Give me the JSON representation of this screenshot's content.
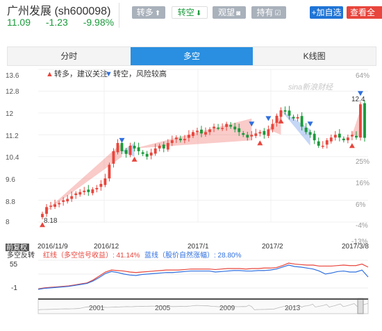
{
  "header": {
    "title": "广州发展 (sh600098)",
    "price": "11.09",
    "change": "-1.23",
    "change_pct": "-9.98%"
  },
  "toolbar": {
    "buttons": [
      {
        "label": "转多",
        "icon": "arrow-up-icon"
      },
      {
        "label": "转空",
        "icon": "arrow-down-icon"
      },
      {
        "label": "观望",
        "icon": "binoculars-icon"
      },
      {
        "label": "持有",
        "icon": "checkbox-icon"
      }
    ],
    "add_label": "+加自选",
    "view_label": "查看全"
  },
  "tabs": [
    {
      "label": "分时",
      "active": false
    },
    {
      "label": "多空",
      "active": true
    },
    {
      "label": "K线图",
      "active": false
    }
  ],
  "chart_data": {
    "type": "candlestick",
    "legend": [
      {
        "marker": "▲",
        "text": "转多，建议关注",
        "color": "#e8453c"
      },
      {
        "marker": "▼",
        "text": "转空，风险较高",
        "color": "#2f6fdf"
      }
    ],
    "watermark": "sina新浪财经",
    "y_ticks_left": [
      "13.6",
      "12.8",
      "12",
      "11.2",
      "10.4",
      "9.6",
      "8.8",
      "8"
    ],
    "y_ticks_right": [
      "64%",
      "",
      "",
      "",
      "",
      "25%",
      "16%",
      "6%",
      "-4%",
      "-13%"
    ],
    "ylim": [
      8.0,
      13.6
    ],
    "x_labels": [
      "2016/11/9",
      "2016/12",
      "2017/1",
      "2017/2",
      "2017/3/8"
    ],
    "low_label": "8.18",
    "high_label": "12.4",
    "closes": [
      8.3,
      8.55,
      8.6,
      8.65,
      8.7,
      8.8,
      8.85,
      8.95,
      9.05,
      9.1,
      9.15,
      9.1,
      9.2,
      9.25,
      9.4,
      9.6,
      10.1,
      10.6,
      10.9,
      10.6,
      10.5,
      10.8,
      10.7,
      10.6,
      10.5,
      10.4,
      10.55,
      10.7,
      10.8,
      10.7,
      10.9,
      11.0,
      11.1,
      11.0,
      11.05,
      11.2,
      11.3,
      11.35,
      11.25,
      11.3,
      11.4,
      11.5,
      11.45,
      11.45,
      11.6,
      11.5,
      11.4,
      11.3,
      11.2,
      11.1,
      11.2,
      11.25,
      11.3,
      11.2,
      11.4,
      11.6,
      11.9,
      12.1,
      12.05,
      11.9,
      11.8,
      11.85,
      11.5,
      11.3,
      11.2,
      11.0,
      10.8,
      10.8,
      11.0,
      11.1,
      11.2,
      11.1,
      11.0,
      11.1,
      11.2,
      11.1,
      12.32,
      11.09
    ],
    "signals": [
      {
        "type": "up",
        "x_frac": 0.0
      },
      {
        "type": "down",
        "x_frac": 0.245
      },
      {
        "type": "up",
        "x_frac": 0.29
      },
      {
        "type": "down",
        "x_frac": 0.655
      },
      {
        "type": "up",
        "x_frac": 0.67
      },
      {
        "type": "down",
        "x_frac": 0.695
      },
      {
        "type": "up",
        "x_frac": 0.745
      },
      {
        "type": "down",
        "x_frac": 0.835
      },
      {
        "type": "up",
        "x_frac": 0.955
      },
      {
        "type": "down",
        "x_frac": 0.985
      }
    ],
    "sub_label_left": "前复权",
    "sub_title": "多空反转",
    "sub_legend_red": "红线（多空信号收益）: 41.14%",
    "sub_legend_blue": "蓝线（股价自然涨幅）: 28.80%",
    "sub_y_ticks": [
      "55",
      "-1"
    ],
    "red_line": [
      0,
      2,
      3,
      4,
      5,
      6,
      8,
      10,
      12,
      18,
      26,
      34,
      38,
      37,
      36,
      34,
      33,
      34,
      35,
      36,
      37,
      38,
      38,
      38,
      39,
      40,
      40,
      40,
      40,
      39,
      40,
      41,
      41,
      41,
      40,
      41,
      41,
      42,
      42,
      43,
      47,
      52,
      50,
      49,
      48,
      48,
      46,
      46,
      46,
      47,
      48,
      47,
      47,
      50,
      44
    ],
    "blue_line": [
      -1,
      1,
      2,
      3,
      4,
      5,
      7,
      9,
      11,
      16,
      23,
      31,
      35,
      33,
      30,
      28,
      27,
      29,
      30,
      31,
      32,
      33,
      33,
      34,
      35,
      36,
      36,
      36,
      36,
      34,
      35,
      36,
      37,
      37,
      36,
      36,
      37,
      37,
      38,
      40,
      44,
      48,
      45,
      44,
      42,
      40,
      36,
      30,
      32,
      35,
      36,
      34,
      34,
      38,
      24
    ],
    "nav_years": [
      "2001",
      "2005",
      "2009",
      "2013"
    ]
  },
  "colors": {
    "up": "#e8453c",
    "down": "#1a9a3b",
    "signal_up": "#e8453c",
    "signal_down": "#2f6fdf",
    "accent": "#2a8fe0"
  }
}
